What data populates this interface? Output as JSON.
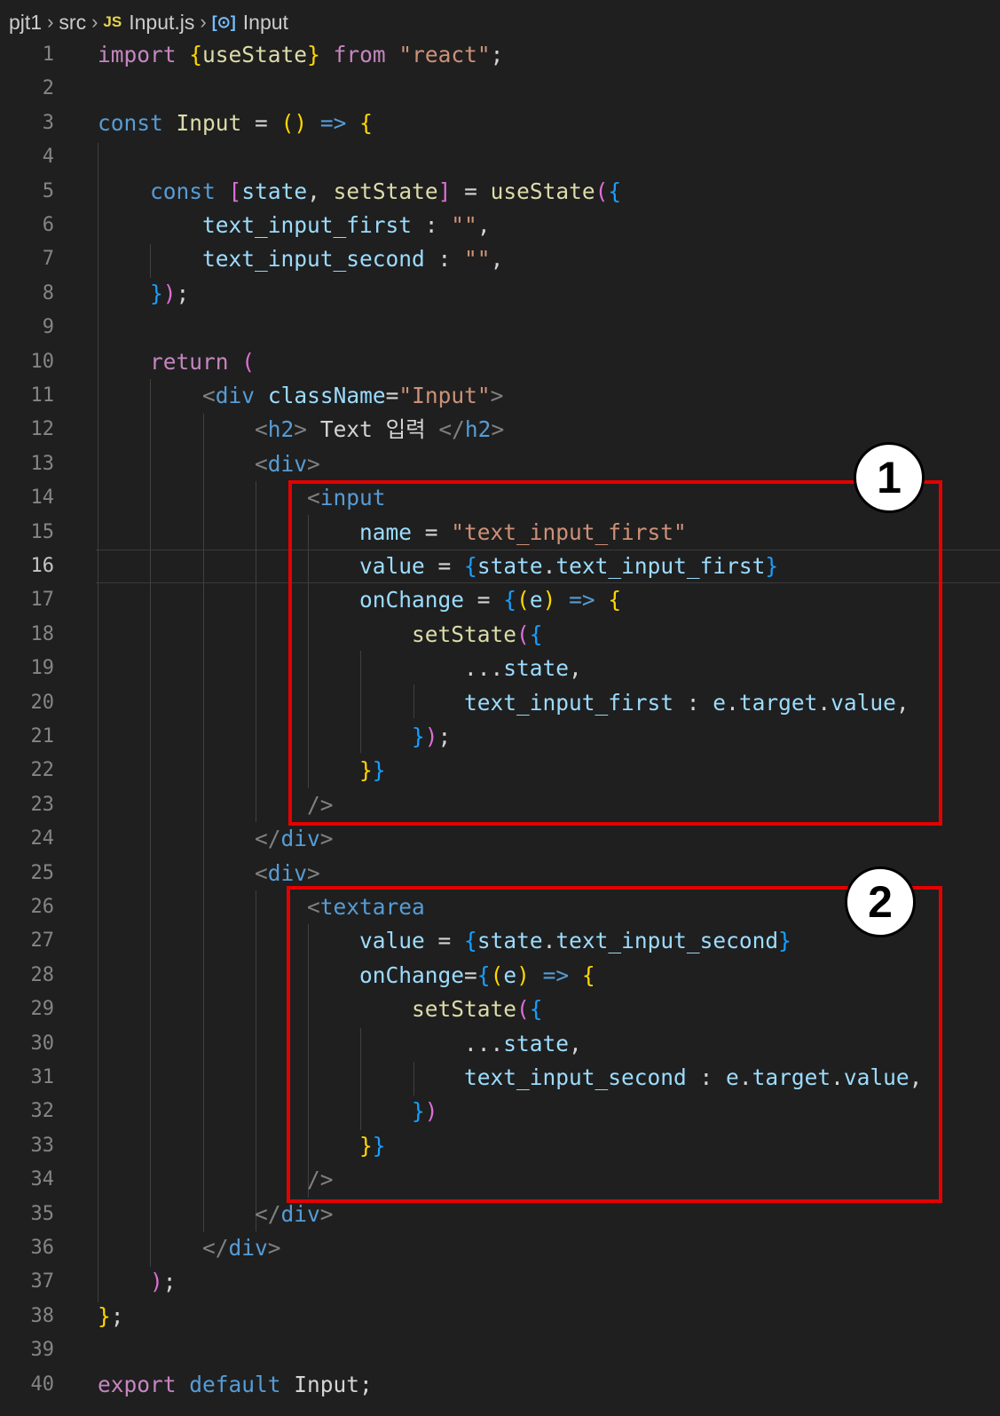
{
  "breadcrumb": {
    "items": [
      "pjt1",
      "src",
      "Input.js",
      "Input"
    ],
    "file_icon": "JS",
    "component_icon": "[⊙]"
  },
  "editor": {
    "active_line": 16,
    "lines": [
      {
        "n": "1",
        "text": "import {useState} from \"react\";"
      },
      {
        "n": "2",
        "text": ""
      },
      {
        "n": "3",
        "text": "const Input = () => {"
      },
      {
        "n": "4",
        "text": ""
      },
      {
        "n": "5",
        "text": "    const [state, setState] = useState({"
      },
      {
        "n": "6",
        "text": "        text_input_first : \"\","
      },
      {
        "n": "7",
        "text": "        text_input_second : \"\","
      },
      {
        "n": "8",
        "text": "    });"
      },
      {
        "n": "9",
        "text": ""
      },
      {
        "n": "10",
        "text": "    return ("
      },
      {
        "n": "11",
        "text": "        <div className=\"Input\">"
      },
      {
        "n": "12",
        "text": "            <h2> Text 입력 </h2>"
      },
      {
        "n": "13",
        "text": "            <div>"
      },
      {
        "n": "14",
        "text": "                <input"
      },
      {
        "n": "15",
        "text": "                    name = \"text_input_first\""
      },
      {
        "n": "16",
        "text": "                    value = {state.text_input_first}"
      },
      {
        "n": "17",
        "text": "                    onChange = {(e) => {"
      },
      {
        "n": "18",
        "text": "                        setState({"
      },
      {
        "n": "19",
        "text": "                            ...state,"
      },
      {
        "n": "20",
        "text": "                            text_input_first : e.target.value,"
      },
      {
        "n": "21",
        "text": "                        });"
      },
      {
        "n": "22",
        "text": "                    }}"
      },
      {
        "n": "23",
        "text": "                />"
      },
      {
        "n": "24",
        "text": "            </div>"
      },
      {
        "n": "25",
        "text": "            <div>"
      },
      {
        "n": "26",
        "text": "                <textarea"
      },
      {
        "n": "27",
        "text": "                    value = {state.text_input_second}"
      },
      {
        "n": "28",
        "text": "                    onChange={(e) => {"
      },
      {
        "n": "29",
        "text": "                        setState({"
      },
      {
        "n": "30",
        "text": "                            ...state,"
      },
      {
        "n": "31",
        "text": "                            text_input_second : e.target.value,"
      },
      {
        "n": "32",
        "text": "                        })"
      },
      {
        "n": "33",
        "text": "                    }}"
      },
      {
        "n": "34",
        "text": "                />"
      },
      {
        "n": "35",
        "text": "            </div>"
      },
      {
        "n": "36",
        "text": "        </div>"
      },
      {
        "n": "37",
        "text": "    );"
      },
      {
        "n": "38",
        "text": "};"
      },
      {
        "n": "39",
        "text": ""
      },
      {
        "n": "40",
        "text": "export default Input;"
      }
    ]
  },
  "annotations": [
    {
      "label": "1",
      "color": "#e50000"
    },
    {
      "label": "2",
      "color": "#e50000"
    }
  ]
}
